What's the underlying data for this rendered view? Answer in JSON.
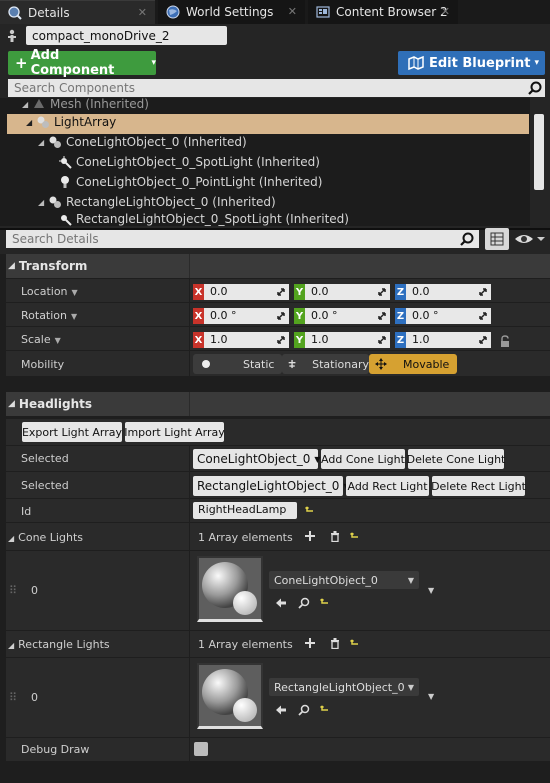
{
  "tabs": [
    {
      "label": "Details",
      "icon": "magnifier-icon"
    },
    {
      "label": "World Settings",
      "icon": "globe-icon"
    },
    {
      "label": "Content Browser 2",
      "icon": "content-browser-icon"
    }
  ],
  "actor": {
    "name": "compact_monoDrive_2"
  },
  "toolbar": {
    "add_component": "Add Component",
    "edit_blueprint": "Edit Blueprint",
    "add_icon": "+",
    "dropdown_glyph": "▾"
  },
  "component_search": {
    "placeholder": "Search Components"
  },
  "tree": [
    {
      "label": "Mesh (Inherited)",
      "icon": "mesh-icon"
    },
    {
      "label": "LightArray",
      "icon": "light-array-icon"
    },
    {
      "label": "ConeLightObject_0 (Inherited)",
      "icon": "scene-component-icon"
    },
    {
      "label": "ConeLightObject_0_SpotLight (Inherited)",
      "icon": "spotlight-icon"
    },
    {
      "label": "ConeLightObject_0_PointLight (Inherited)",
      "icon": "pointlight-icon"
    },
    {
      "label": "RectangleLightObject_0 (Inherited)",
      "icon": "scene-component-icon"
    },
    {
      "label": "RectangleLightObject_0_SpotLight (Inherited)",
      "icon": "spotlight-icon"
    }
  ],
  "details_search": {
    "placeholder": "Search Details"
  },
  "transform": {
    "title": "Transform",
    "location": {
      "label": "Location",
      "x": "0.0",
      "y": "0.0",
      "z": "0.0"
    },
    "rotation": {
      "label": "Rotation",
      "x": "0.0 °",
      "y": "0.0 °",
      "z": "0.0 °"
    },
    "scale": {
      "label": "Scale",
      "x": "1.0",
      "y": "1.0",
      "z": "1.0"
    },
    "axis_labels": {
      "x": "X",
      "y": "Y",
      "z": "Z"
    },
    "mobility": {
      "label": "Mobility",
      "options": [
        "Static",
        "Stationary",
        "Movable"
      ],
      "selected": "Movable"
    }
  },
  "headlights": {
    "title": "Headlights",
    "export_btn": "Export Light Array",
    "import_btn": "Import Light Array",
    "selected_cone": {
      "label": "Selected",
      "value": "ConeLightObject_0",
      "add": "Add Cone Light",
      "delete": "Delete Cone Light"
    },
    "selected_rect": {
      "label": "Selected",
      "value": "RectangleLightObject_0",
      "add": "Add Rect Light",
      "delete": "Delete Rect Light"
    },
    "id": {
      "label": "Id",
      "value": "RightHeadLamp"
    },
    "cone_lights": {
      "label": "Cone Lights",
      "count": "1 Array elements",
      "index": "0",
      "asset": "ConeLightObject_0"
    },
    "rect_lights": {
      "label": "Rectangle Lights",
      "count": "1 Array elements",
      "index": "0",
      "asset": "RectangleLightObject_0"
    },
    "debug_draw": {
      "label": "Debug Draw",
      "checked": false
    }
  },
  "colors": {
    "add_component": "#3e9b3e",
    "edit_blueprint": "#2f6fb8",
    "selected_row": "#d7b68d",
    "movable": "#d6a131"
  }
}
